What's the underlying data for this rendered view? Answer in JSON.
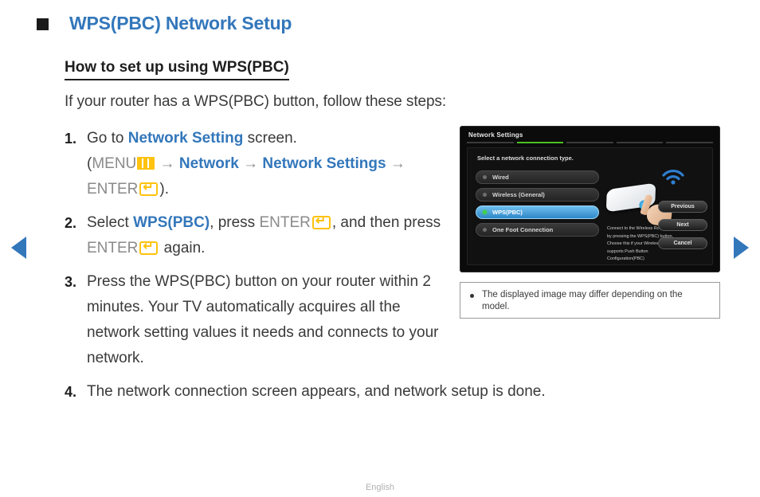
{
  "header": {
    "bullet": "filled-square",
    "title": "WPS(PBC) Network Setup",
    "title_color": "#3377bb"
  },
  "subheading": "How to set up using WPS(PBC)",
  "intro": "If your router has a WPS(PBC) button, follow these steps:",
  "steps": [
    {
      "num": "1.",
      "parts": {
        "p1": "Go to ",
        "p2": "Network Setting",
        "p3": " screen.",
        "p4": "(",
        "p5": "MENU",
        "icon1": "menu-icon",
        "p6": " → ",
        "p7": "Network",
        "p8": " → ",
        "p9": "Network Settings",
        "p10": " → ",
        "p11": "ENTER",
        "icon2": "enter-icon",
        "p12": ")."
      }
    },
    {
      "num": "2.",
      "parts": {
        "p1": "Select ",
        "p2": "WPS(PBC)",
        "p3": ", press ",
        "p4": "ENTER",
        "icon1": "enter-icon",
        "p5": ", and then press ",
        "p6": "ENTER",
        "icon2": "enter-icon",
        "p7": " again."
      }
    },
    {
      "num": "3.",
      "text": "Press the WPS(PBC) button on your router within 2 minutes. Your TV automatically acquires all the network setting values it needs and connects to your network."
    },
    {
      "num": "4.",
      "text": "The network connection screen appears, and network setup is done."
    }
  ],
  "tv_screen": {
    "title": "Network Settings",
    "progress_segments": 5,
    "active_segment": 2,
    "active_color": "#4cc122",
    "prompt": "Select a network connection type.",
    "options": [
      {
        "label": "Wired",
        "selected": false
      },
      {
        "label": "Wireless (General)",
        "selected": false
      },
      {
        "label": "WPS(PBC)",
        "selected": true
      },
      {
        "label": "One Foot Connection",
        "selected": false
      }
    ],
    "description": "Connect to the Wireless Router easily by pressing the WPS(PBC) button. Choose this if your Wireless Router supports Push Button Configuration(PBC)",
    "buttons": [
      {
        "label": "Previous"
      },
      {
        "label": "Next"
      },
      {
        "label": "Cancel"
      }
    ],
    "illustration": "wireless-router-press-button"
  },
  "note": {
    "bullet": "●",
    "text": "The displayed image may differ depending on the model."
  },
  "nav": {
    "prev_icon": "triangle-left-icon",
    "next_icon": "triangle-right-icon",
    "color": "#3377bb"
  },
  "footer": {
    "language": "English"
  }
}
